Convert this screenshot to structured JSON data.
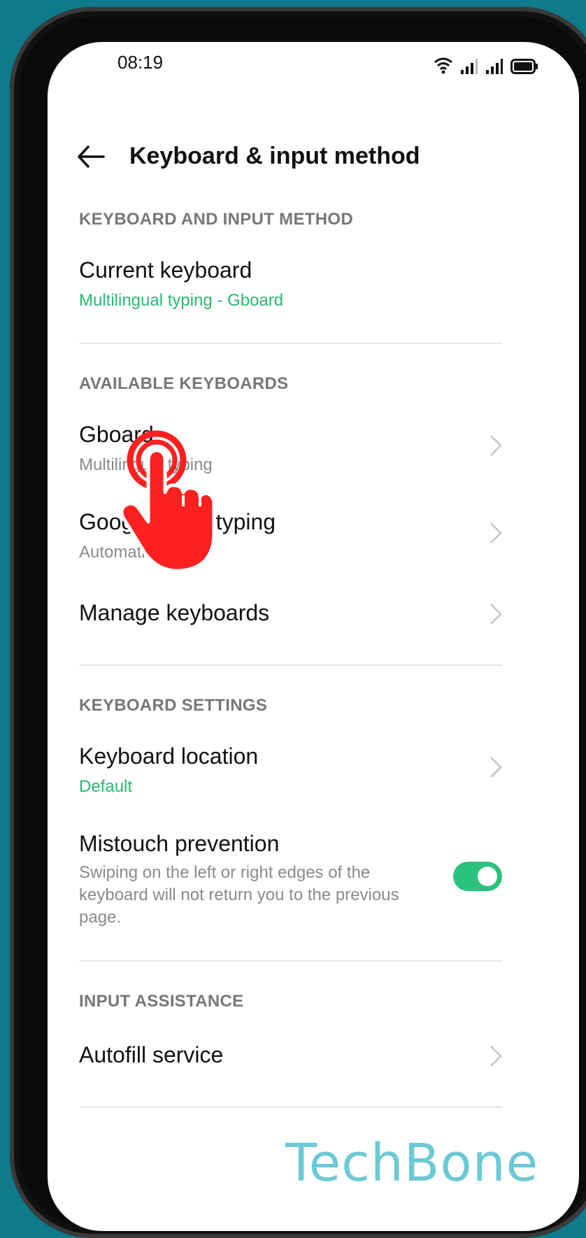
{
  "status": {
    "time": "08:19"
  },
  "appbar": {
    "title": "Keyboard & input method"
  },
  "sections": {
    "kbd_input": "KEYBOARD AND INPUT METHOD",
    "available": "AVAILABLE KEYBOARDS",
    "settings": "KEYBOARD SETTINGS",
    "assist": "INPUT ASSISTANCE"
  },
  "items": {
    "current": {
      "title": "Current keyboard",
      "sub": "Multilingual typing - Gboard"
    },
    "gboard": {
      "title": "Gboard",
      "sub": "Multilingual typing"
    },
    "google_voice": {
      "title": "Google voice typing",
      "sub": "Automatic"
    },
    "manage": {
      "title": "Manage keyboards"
    },
    "location": {
      "title": "Keyboard location",
      "sub": "Default"
    },
    "mistouch": {
      "title": "Mistouch prevention",
      "desc": "Swiping on the left or right edges of the keyboard will not return you to the previous page.",
      "enabled": true
    },
    "autofill": {
      "title": "Autofill service"
    }
  },
  "watermark": "TechBone",
  "colors": {
    "accent": "#2bc27b",
    "tap_indicator": "#ff2020",
    "background": "#0e7a8a"
  }
}
